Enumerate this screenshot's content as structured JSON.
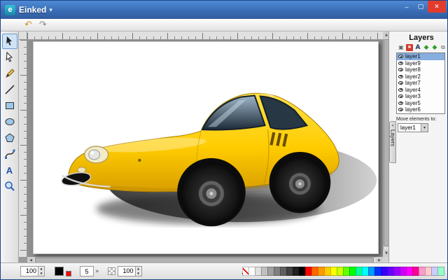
{
  "window": {
    "title": "Einked",
    "menu_caret": "▾",
    "controls": {
      "minimize": "–",
      "maximize": "▢",
      "close": "✕"
    }
  },
  "toolbar": {
    "buttons": [
      {
        "name": "undo",
        "glyph": "↶"
      },
      {
        "name": "redo",
        "glyph": "↷"
      }
    ]
  },
  "tools": {
    "items": [
      "select",
      "node",
      "pencil",
      "line",
      "rect",
      "ellipse",
      "polygon",
      "path",
      "text",
      "zoom"
    ],
    "active_tool": "select",
    "text_glyph": "A"
  },
  "layers_panel": {
    "title": "Layers",
    "tab_label": "Layers",
    "tab_arrow": "«",
    "buttons": [
      "new-layer",
      "delete-layer",
      "rename-layer",
      "move-layer-up",
      "move-layer-down",
      "merge-layer"
    ],
    "button_glyphs": {
      "new": "▣",
      "delete": "✖",
      "rename": "A",
      "up": "◆",
      "down": "◆",
      "merge": "⧉"
    },
    "layers": [
      {
        "name": "layer1",
        "selected": true
      },
      {
        "name": "layer9",
        "selected": false
      },
      {
        "name": "layer8",
        "selected": false
      },
      {
        "name": "layer2",
        "selected": false
      },
      {
        "name": "layer7",
        "selected": false
      },
      {
        "name": "layer4",
        "selected": false
      },
      {
        "name": "layer3",
        "selected": false
      },
      {
        "name": "layer5",
        "selected": false
      },
      {
        "name": "layer6",
        "selected": false
      }
    ],
    "move_label": "Move elements to:",
    "move_target": "layer1",
    "select_caret": "▾"
  },
  "statusbar": {
    "zoom_value": "100",
    "stroke_width": "5",
    "opacity_value": "100",
    "spinner_up": "▲",
    "spinner_down": "▼",
    "more_glyph": "»",
    "fill_color": "#000000",
    "stroke_color": "#ff0000",
    "palette": [
      "none",
      "#ffffff",
      "#e0e0e0",
      "#c0c0c0",
      "#a0a0a0",
      "#808080",
      "#606060",
      "#404040",
      "#202020",
      "#000000",
      "#ff0000",
      "#ff6600",
      "#ff9900",
      "#ffcc00",
      "#ffff00",
      "#ccff00",
      "#66ff00",
      "#00ff00",
      "#00ff99",
      "#00ffff",
      "#0099ff",
      "#0033ff",
      "#3300ff",
      "#6600ff",
      "#9900ff",
      "#cc00ff",
      "#ff00ff",
      "#ff0099",
      "#ff99cc",
      "#ffcccc",
      "#ccccff",
      "#99ffcc"
    ]
  },
  "scrollbars": {
    "up": "▲",
    "down": "▼",
    "left": "◀",
    "right": "▶"
  },
  "colors": {
    "titlebar": "#3a6db5",
    "selection_highlight": "#86aede",
    "car_body": "#ffd21e",
    "workspace_bg": "#8f8f8f"
  }
}
